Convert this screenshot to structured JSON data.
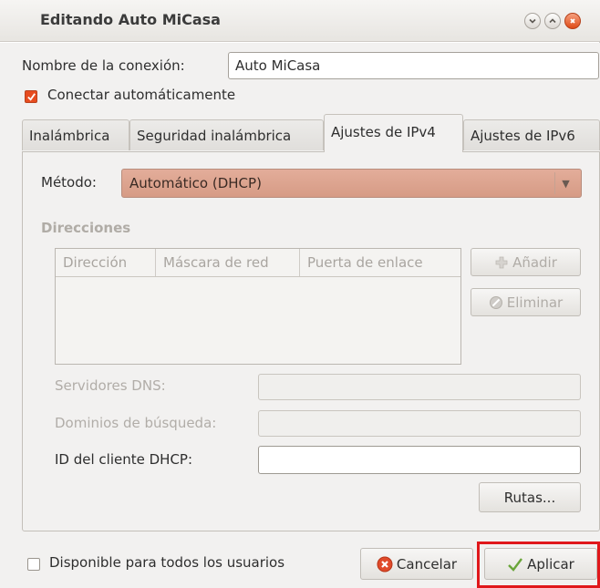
{
  "window": {
    "title": "Editando Auto MiCasa"
  },
  "connection": {
    "name_label": "Nombre de la conexión:",
    "name_value": "Auto MiCasa",
    "auto_connect_label": "Conectar automáticamente",
    "auto_connect_checked": true
  },
  "tabs": [
    {
      "label": "Inalámbrica",
      "active": false
    },
    {
      "label": "Seguridad inalámbrica",
      "active": false
    },
    {
      "label": "Ajustes de IPv4",
      "active": true
    },
    {
      "label": "Ajustes de IPv6",
      "active": false
    }
  ],
  "ipv4": {
    "method_label": "Método:",
    "method_value": "Automático (DHCP)",
    "addresses_heading": "Direcciones",
    "columns": [
      "Dirección",
      "Máscara de red",
      "Puerta de enlace"
    ],
    "add_label": "Añadir",
    "remove_label": "Eliminar",
    "dns_label": "Servidores DNS:",
    "dns_value": "",
    "search_domains_label": "Dominios de búsqueda:",
    "search_domains_value": "",
    "dhcp_client_id_label": "ID del cliente DHCP:",
    "dhcp_client_id_value": "",
    "routes_label": "Rutas..."
  },
  "footer": {
    "all_users_label": "Disponible para todos los usuarios",
    "all_users_checked": false,
    "cancel_label": "Cancelar",
    "apply_label": "Aplicar"
  },
  "colors": {
    "accent": "#e74c1f",
    "method_combo": "#dba28d",
    "highlight": "#e0181b"
  }
}
